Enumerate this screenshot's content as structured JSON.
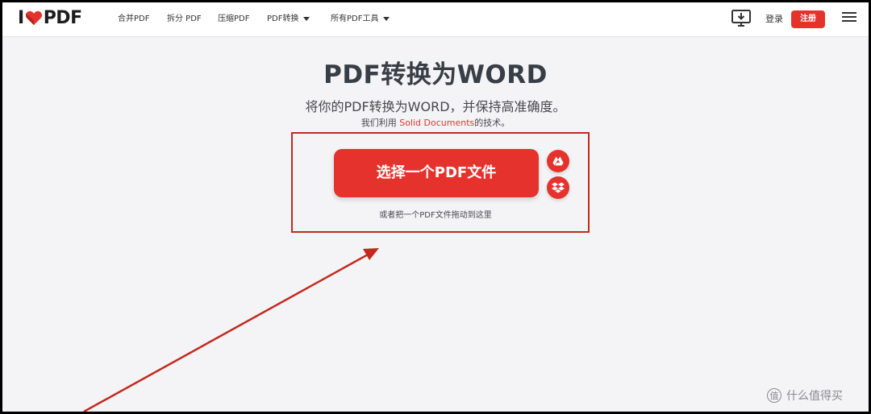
{
  "header": {
    "logo_left": "I",
    "logo_right": "PDF",
    "nav": [
      {
        "label": "合并PDF"
      },
      {
        "label": "拆分 PDF"
      },
      {
        "label": "压缩PDF"
      },
      {
        "label": "PDF转换"
      },
      {
        "label": "所有PDF工具"
      }
    ],
    "login": "登录",
    "signup": "注册",
    "icons": [
      "desktop-download-icon",
      "hamburger-menu-icon"
    ]
  },
  "main": {
    "title": "PDF转换为WORD",
    "subtitle": "将你的PDF转换为WORD，并保持高准确度。",
    "tech_prefix": "我们利用 ",
    "tech_link": "Solid Documents",
    "tech_suffix": "的技术。",
    "select_button": "选择一个PDF文件",
    "drop_hint": "或者把一个PDF文件拖动到这里",
    "cloud_icons": [
      "google-drive-icon",
      "dropbox-icon"
    ]
  },
  "watermark": {
    "badge": "值",
    "text": "什么值得买"
  },
  "colors": {
    "accent": "#e5322d",
    "annotation": "#c22a1f",
    "background": "#f4f4f6"
  }
}
